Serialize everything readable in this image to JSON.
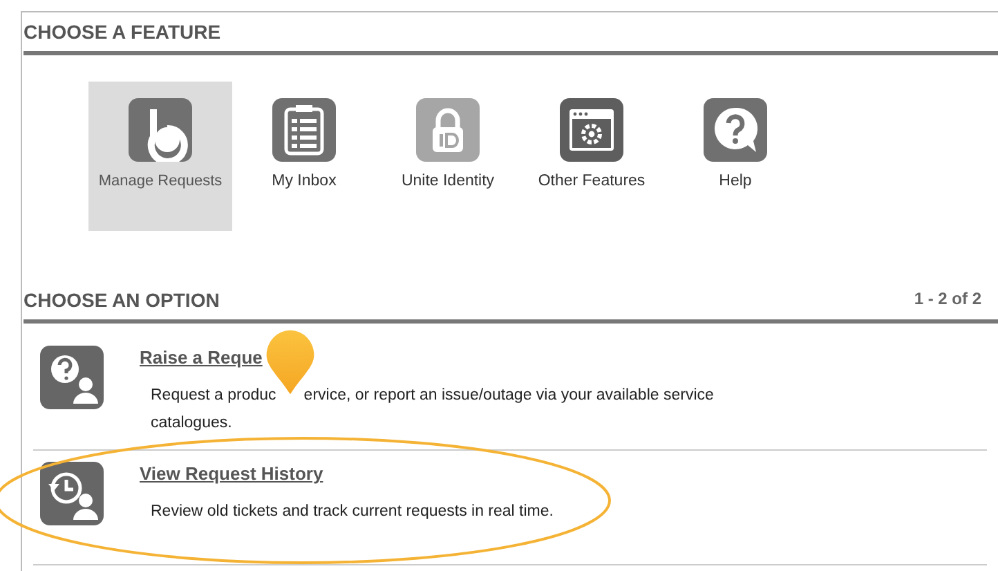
{
  "features_section": {
    "title": "CHOOSE A FEATURE",
    "features": [
      {
        "label": "Manage Requests",
        "kind": "hand",
        "selected": true
      },
      {
        "label": "My Inbox",
        "kind": "clipboard",
        "selected": false
      },
      {
        "label": "Unite Identity",
        "kind": "lock",
        "selected": false
      },
      {
        "label": "Other Features",
        "kind": "window",
        "selected": false
      },
      {
        "label": "Help",
        "kind": "help",
        "selected": false
      }
    ]
  },
  "options_section": {
    "title": "CHOOSE AN OPTION",
    "count": "1 - 2 of 2",
    "options": [
      {
        "title": "Raise a Reque",
        "kind": "question",
        "description_lines": [
          [
            "Request a produc",
            "ervice, or report an issue/outage via your available service"
          ],
          [
            "catalogues."
          ]
        ]
      },
      {
        "title": "View Request History",
        "kind": "history",
        "description_lines": [
          [
            "Review old tickets and track current requests in real time."
          ]
        ]
      }
    ]
  }
}
